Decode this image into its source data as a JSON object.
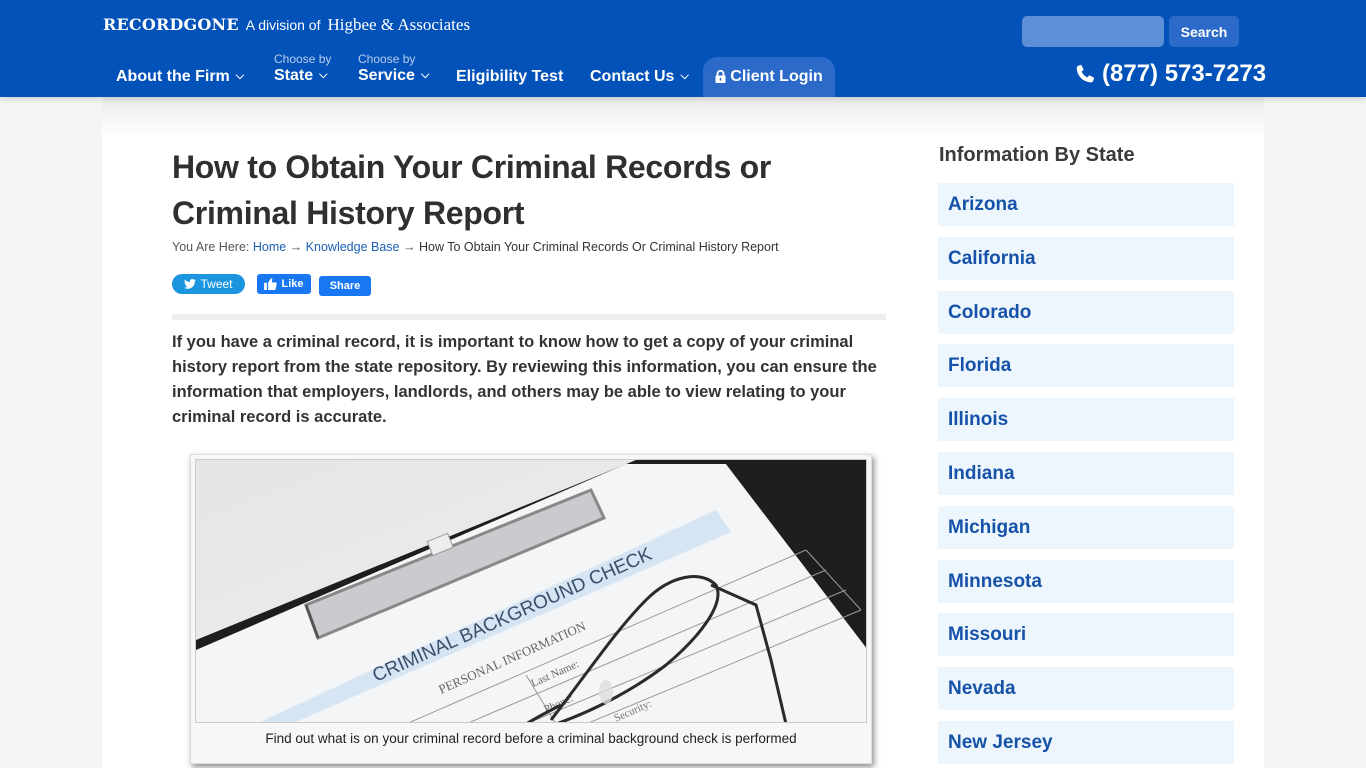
{
  "header": {
    "logo": "RECORDGONE",
    "division_text": "A division of",
    "parent_company": "Higbee & Associates",
    "nav": [
      {
        "label": "About the Firm",
        "sub": "",
        "has_dropdown": true
      },
      {
        "label": "State",
        "sub": "Choose by",
        "has_dropdown": true
      },
      {
        "label": "Service",
        "sub": "Choose by",
        "has_dropdown": true
      },
      {
        "label": "Eligibility Test",
        "sub": "",
        "has_dropdown": false
      },
      {
        "label": "Contact Us",
        "sub": "",
        "has_dropdown": true
      }
    ],
    "client_login": {
      "label": "Client Login",
      "icon": "lock-icon"
    },
    "search": {
      "placeholder": "",
      "value": "",
      "button_label": "Search"
    },
    "phone": {
      "number": "(877) 573-7273",
      "icon": "phone-icon"
    }
  },
  "article": {
    "title": "How to Obtain Your Criminal Records or Criminal History Report",
    "breadcrumb": {
      "prefix": "You Are Here:",
      "separator": "→",
      "items": [
        {
          "label": "Home",
          "link": true
        },
        {
          "label": "Knowledge Base",
          "link": true
        },
        {
          "label": "How To Obtain Your Criminal Records Or Criminal History Report",
          "link": false
        }
      ]
    },
    "social": {
      "tweet_label": "Tweet",
      "like_label": "Like",
      "share_label": "Share"
    },
    "intro": "If you have a criminal record, it is important to know how to get a copy of your criminal history report from the state repository. By reviewing this information, you can ensure the information that employers, landlords, and others may be able to view relating to your criminal record is accurate.",
    "figure": {
      "image_text": {
        "heading": "CRIMINAL BACKGROUND CHECK",
        "section": "PERSONAL INFORMATION",
        "field1": "Last Name:",
        "field2": "Phone:",
        "field3": "Security:"
      },
      "caption": "Find out what is on your criminal record before a criminal background check is performed"
    }
  },
  "sidebar": {
    "title": "Information By State",
    "states": [
      "Arizona",
      "California",
      "Colorado",
      "Florida",
      "Illinois",
      "Indiana",
      "Michigan",
      "Minnesota",
      "Missouri",
      "Nevada",
      "New Jersey"
    ]
  },
  "colors": {
    "header_bg": "#0352b9",
    "login_tab_bg": "#2b6ac8",
    "link": "#1a5fb4",
    "state_item_bg": "#eef6fd",
    "state_item_text": "#1552a8"
  }
}
